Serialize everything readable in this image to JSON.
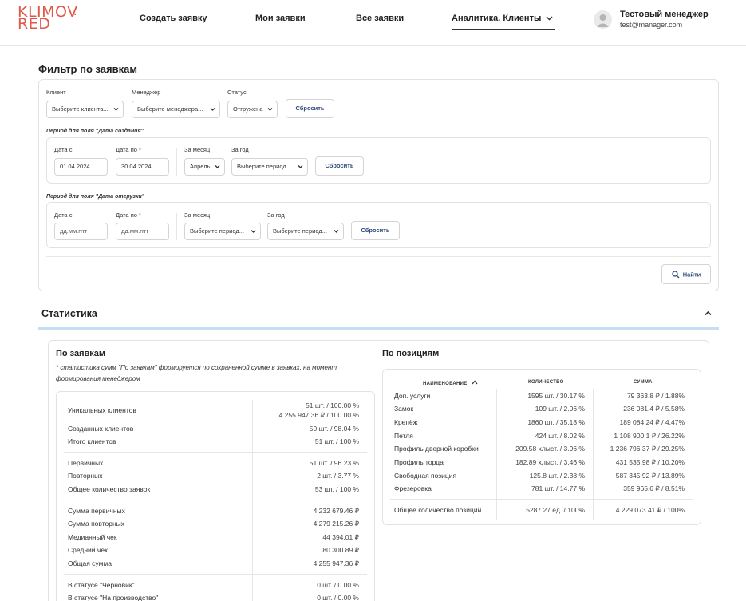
{
  "header": {
    "logo_line1": "KLIMOV",
    "logo_line2": "RED",
    "logo_dot": ".",
    "nav": [
      {
        "label": "Создать заявку"
      },
      {
        "label": "Мои заявки"
      },
      {
        "label": "Все заявки"
      },
      {
        "label": "Аналитика. Клиенты"
      }
    ],
    "user_name": "Тестовый менеджер",
    "user_email": "test@manager.com"
  },
  "filter": {
    "title": "Фильтр по заявкам",
    "client_label": "Клиент",
    "client_value": "Выберите клиента...",
    "manager_label": "Менеджер",
    "manager_value": "Выберите менеджера...",
    "status_label": "Статус",
    "status_value": "Отгружена",
    "reset_label": "Сбросить",
    "created_period": {
      "title": "Период для поля \"Дата создания\"",
      "date_from_label": "Дата с",
      "date_from_value": "01.04.2024",
      "date_to_label": "Дата по *",
      "date_to_value": "30.04.2024",
      "month_label": "За месяц",
      "month_value": "Апрель",
      "year_label": "За год",
      "year_value": "Выберите период...",
      "reset_label": "Сбросить"
    },
    "shipped_period": {
      "title": "Период для поля \"Дата отгрузки\"",
      "date_from_label": "Дата с",
      "date_from_placeholder": "дд.мм.гггг",
      "date_to_label": "Дата по *",
      "date_to_placeholder": "дд.мм.гггг",
      "month_label": "За месяц",
      "month_value": "Выберите период...",
      "year_label": "За год",
      "year_value": "Выберите период...",
      "reset_label": "Сбросить"
    },
    "find_label": "Найти"
  },
  "stats": {
    "title": "Статистика",
    "by_orders": {
      "title": "По заявкам",
      "note": "* статистика сумм \"По заявкам\" формируется по сохраненной сумме в заявках, на момент формирования менеджером",
      "groups": [
        [
          {
            "label": "Уникальных клиентов",
            "value": "51 шт. / 100.00 %",
            "value2": "4 255 947.36 ₽ / 100.00 %"
          },
          {
            "label": "Созданных клиентов",
            "value": "50 шт. / 98.04 %"
          },
          {
            "label": "Итого клиентов",
            "value": "51 шт. / 100 %"
          }
        ],
        [
          {
            "label": "Первичных",
            "value": "51 шт. / 96.23 %"
          },
          {
            "label": "Повторных",
            "value": "2 шт. / 3.77 %"
          },
          {
            "label": "Общее количество заявок",
            "value": "53 шт. / 100 %"
          }
        ],
        [
          {
            "label": "Сумма первичных",
            "value": "4 232 679.46 ₽"
          },
          {
            "label": "Сумма повторных",
            "value": "4 279 215.26 ₽"
          },
          {
            "label": "Медианный чек",
            "value": "44 394.01 ₽"
          },
          {
            "label": "Средний чек",
            "value": "80 300.89 ₽"
          },
          {
            "label": "Общая сумма",
            "value": "4 255 947.36 ₽"
          }
        ],
        [
          {
            "label": "В статусе \"Черновик\"",
            "value": "0 шт. / 0.00 %"
          },
          {
            "label": "В статусе \"На производство\"",
            "value": "0 шт. / 0.00 %"
          }
        ]
      ]
    },
    "by_positions": {
      "title": "По позициям",
      "headers": [
        "НАИМЕНОВАНИЕ",
        "КОЛИЧЕСТВО",
        "СУММА"
      ],
      "rows": [
        {
          "name": "Доп. услуги",
          "qty": "1595 шт. / 30.17 %",
          "sum": "79 363.8 ₽ / 1.88%"
        },
        {
          "name": "Замок",
          "qty": "109 шт. / 2.06 %",
          "sum": "236 081.4 ₽ / 5.58%"
        },
        {
          "name": "Крепёж",
          "qty": "1860 шт. / 35.18 %",
          "sum": "189 084.24 ₽ / 4.47%"
        },
        {
          "name": "Петля",
          "qty": "424 шт. / 8.02 %",
          "sum": "1 108 900.1 ₽ / 26.22%"
        },
        {
          "name": "Профиль дверной коробки",
          "qty": "209.58 хлыст. / 3.96 %",
          "sum": "1 236 796.37 ₽ / 29.25%"
        },
        {
          "name": "Профиль торца",
          "qty": "182.89 хлыст. / 3.46 %",
          "sum": "431 535.98 ₽ / 10.20%"
        },
        {
          "name": "Свободная позиция",
          "qty": "125.8 шт. / 2.38 %",
          "sum": "587 345.92 ₽ / 13.89%"
        },
        {
          "name": "Фрезеровка",
          "qty": "781 шт. / 14.77 %",
          "sum": "359 965.6 ₽ / 8.51%"
        }
      ],
      "total": {
        "name": "Общее количество позиций",
        "qty": "5287.27 ед. / 100%",
        "sum": "4 229 073.41 ₽ / 100%"
      }
    }
  }
}
